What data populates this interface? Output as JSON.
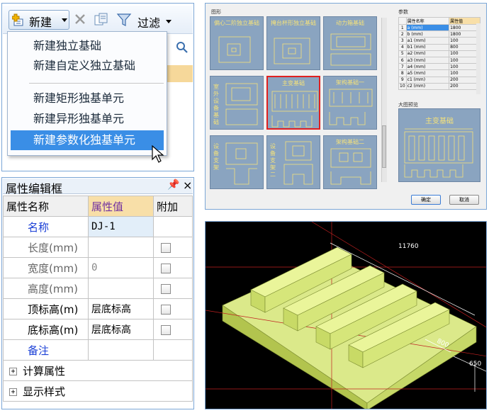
{
  "toolbar": {
    "new_label": "新建",
    "filter_label": "过滤"
  },
  "dropdown": {
    "items": [
      "新建独立基础",
      "新建自定义独立基础",
      "新建矩形独基单元",
      "新建异形独基单元",
      "新建参数化独基单元"
    ],
    "selected_index": 4
  },
  "properties": {
    "title": "属性编辑框",
    "pin": "ᵖ",
    "close": "×",
    "headers": [
      "属性名称",
      "属性值",
      "附加"
    ],
    "rows": [
      {
        "name": "名称",
        "value": "DJ-1",
        "style": "blue",
        "checkbox": false
      },
      {
        "name": "长度(mm)",
        "value": "",
        "style": "sub",
        "checkbox": true
      },
      {
        "name": "宽度(mm)",
        "value": "0",
        "style": "sub",
        "checkbox": true
      },
      {
        "name": "高度(mm)",
        "value": "",
        "style": "sub",
        "checkbox": true
      },
      {
        "name": "顶标高(m)",
        "value": "层底标高",
        "style": "normal",
        "checkbox": true
      },
      {
        "name": "底标高(m)",
        "value": "层底标高",
        "style": "normal",
        "checkbox": true
      },
      {
        "name": "备注",
        "value": "",
        "style": "blue",
        "checkbox": false
      }
    ],
    "groups": [
      "计算属性",
      "显示样式"
    ]
  },
  "dialog": {
    "shapes_label": "图形",
    "params_label": "参数",
    "preview_label": "大图预览",
    "tiles": [
      {
        "title": "偏心二阶独立基础",
        "vertical": false
      },
      {
        "title": "掩台杯形独立基础",
        "vertical": false
      },
      {
        "title": "动力箱基础",
        "vertical": false
      },
      {
        "title": "室外设备基础",
        "vertical": true
      },
      {
        "title": "主变基础",
        "vertical": false,
        "selected": true
      },
      {
        "title": "架构基础一",
        "vertical": false
      },
      {
        "title": "设备支架",
        "vertical": true
      },
      {
        "title": "设备支架二",
        "vertical": true
      },
      {
        "title": "架构基础二",
        "vertical": false
      }
    ],
    "param_headers": [
      "属性名称",
      "属性值"
    ],
    "params": [
      {
        "n": "1",
        "name": "a (mm)",
        "value": "1800"
      },
      {
        "n": "2",
        "name": "b (mm)",
        "value": "1800"
      },
      {
        "n": "3",
        "name": "a1 (mm)",
        "value": "100"
      },
      {
        "n": "4",
        "name": "b1 (mm)",
        "value": "800"
      },
      {
        "n": "5",
        "name": "a2 (mm)",
        "value": "100"
      },
      {
        "n": "6",
        "name": "a3 (mm)",
        "value": "100"
      },
      {
        "n": "7",
        "name": "a4 (mm)",
        "value": "100"
      },
      {
        "n": "8",
        "name": "a5 (mm)",
        "value": "100"
      },
      {
        "n": "9",
        "name": "c1 (mm)",
        "value": "200"
      },
      {
        "n": "10",
        "name": "c2 (mm)",
        "value": "200"
      }
    ],
    "preview_title": "主变基础",
    "ok_label": "确定",
    "cancel_label": "取消"
  },
  "view3d": {
    "dim_top": "11760",
    "dim_mid": "800",
    "dim_right": "650"
  },
  "colors": {
    "menu_highlight": "#3a8ee6",
    "tile_bg": "#8aa4c0",
    "tile_line": "#f5e27a",
    "solid_top": "#e0f08a",
    "solid_side": "#b8cc58"
  }
}
